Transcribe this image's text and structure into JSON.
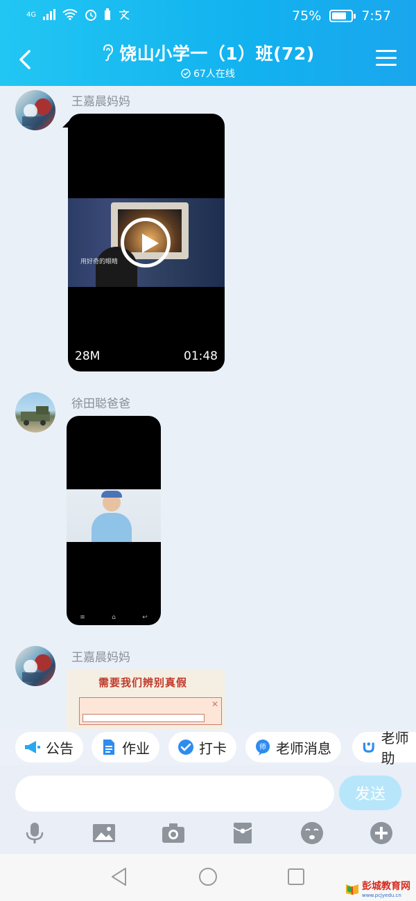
{
  "status_bar": {
    "network": "4G",
    "battery_percent": "75%",
    "battery_level": 0.75,
    "time": "7:57"
  },
  "header": {
    "title": "饶山小学一（1）班(72)",
    "online": "67人在线"
  },
  "messages": [
    {
      "sender": "王嘉晨妈妈",
      "type": "video",
      "size": "28M",
      "duration": "01:48",
      "frame_caption": "用好奇的眼睛"
    },
    {
      "sender": "徐田聪爸爸",
      "type": "video"
    },
    {
      "sender": "王嘉晨妈妈",
      "type": "image",
      "caption": "需要我们辨别真假"
    }
  ],
  "quick_actions": [
    {
      "label": "公告",
      "icon": "megaphone-icon"
    },
    {
      "label": "作业",
      "icon": "document-icon"
    },
    {
      "label": "打卡",
      "icon": "checkin-icon"
    },
    {
      "label": "老师消息",
      "icon": "teacher-message-icon"
    },
    {
      "label": "老师助",
      "icon": "teacher-assistant-icon"
    }
  ],
  "input": {
    "placeholder": "",
    "send_label": "发送"
  },
  "toolbar": [
    "microphone-icon",
    "image-icon",
    "camera-icon",
    "red-packet-icon",
    "emoji-icon",
    "plus-icon"
  ],
  "watermark": {
    "text": "彭城教育网",
    "url": "www.pcjyedu.cn"
  },
  "colors": {
    "header_start": "#22c6f3",
    "header_end": "#1aa6ee",
    "background": "#eaf0f8",
    "send_button": "#b7e6fb"
  }
}
